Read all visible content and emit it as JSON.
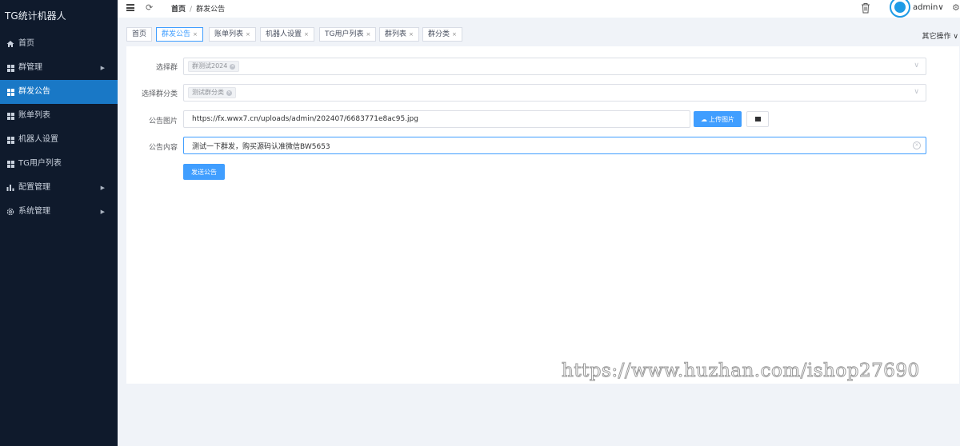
{
  "sidebar": {
    "brand": "TG统计机器人",
    "items": [
      {
        "label": "首页",
        "icon": "home-icon",
        "has_arrow": false,
        "active": false
      },
      {
        "label": "群管理",
        "icon": "grid-icon",
        "has_arrow": true,
        "active": false
      },
      {
        "label": "群发公告",
        "icon": "grid-icon",
        "has_arrow": false,
        "active": true
      },
      {
        "label": "账单列表",
        "icon": "grid-icon",
        "has_arrow": false,
        "active": false
      },
      {
        "label": "机器人设置",
        "icon": "grid-icon",
        "has_arrow": false,
        "active": false
      },
      {
        "label": "TG用户列表",
        "icon": "grid-icon",
        "has_arrow": false,
        "active": false
      },
      {
        "label": "配置管理",
        "icon": "bar-chart-icon",
        "has_arrow": true,
        "active": false
      },
      {
        "label": "系统管理",
        "icon": "gear-icon",
        "has_arrow": true,
        "active": false
      }
    ]
  },
  "header": {
    "breadcrumb_home": "首页",
    "breadcrumb_sep": "/",
    "breadcrumb_current": "群发公告",
    "username": "admin",
    "username_caret": "∨"
  },
  "tags": [
    {
      "label": "首页",
      "closable": false,
      "active": false
    },
    {
      "label": "群发公告",
      "closable": true,
      "active": true
    },
    {
      "label": "账单列表",
      "closable": true,
      "active": false
    },
    {
      "label": "机器人设置",
      "closable": true,
      "active": false
    },
    {
      "label": "TG用户列表",
      "closable": true,
      "active": false
    },
    {
      "label": "群列表",
      "closable": true,
      "active": false
    },
    {
      "label": "群分类",
      "closable": true,
      "active": false
    }
  ],
  "other_ops": "其它操作 ∨",
  "form": {
    "group_label": "选择群",
    "group_chip": "群测试2024",
    "category_label": "选择群分类",
    "category_chip": "测试群分类",
    "image_label": "公告图片",
    "image_value": "https://fx.wwx7.cn/uploads/admin/202407/6683771e8ac95.jpg",
    "upload_label": "上传图片",
    "content_label": "公告内容",
    "content_value": "测试一下群发，购买源码认准微信BW5653",
    "send_label": "发送公告"
  },
  "watermark": "https://www.huzhan.com/ishop27690",
  "colors": {
    "sidebar_bg": "#0f1a2c",
    "sidebar_active": "#1978c6",
    "primary": "#409eff"
  }
}
